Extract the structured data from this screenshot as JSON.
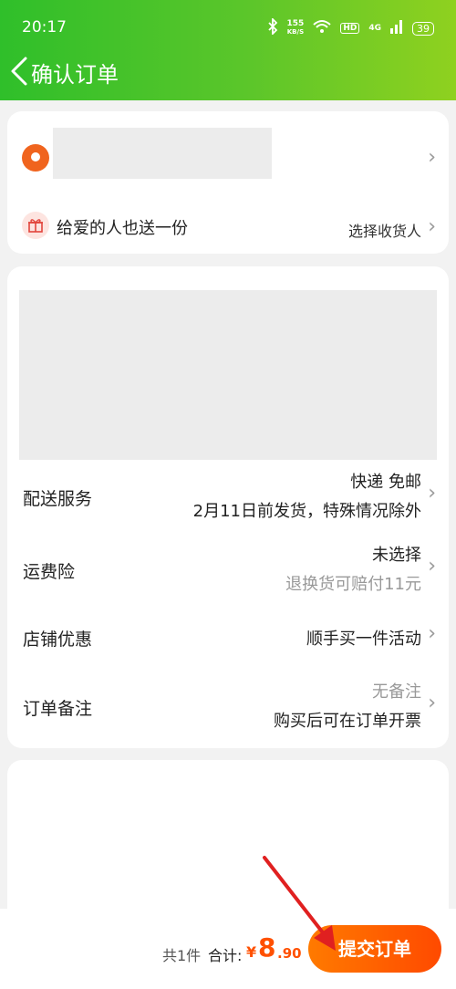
{
  "status_bar": {
    "time": "20:17",
    "speed_value": "155",
    "speed_unit": "KB/S",
    "hd": "HD",
    "network": "4G",
    "battery": "39"
  },
  "nav": {
    "title": "确认订单"
  },
  "address": {
    "gift_text": "给爱的人也送一份",
    "gift_action": "选择收货人"
  },
  "rows": {
    "delivery": {
      "label": "配送服务",
      "value1": "快递 免邮",
      "value2": "2月11日前发货，特殊情况除外"
    },
    "insurance": {
      "label": "运费险",
      "value1": "未选择",
      "value2": "退换货可赔付11元"
    },
    "discount": {
      "label": "店铺优惠",
      "value1": "顺手买一件活动"
    },
    "note": {
      "label": "订单备注",
      "value1": "无备注",
      "value2": "购买后可在订单开票"
    }
  },
  "footer": {
    "count": "共1件",
    "total_label": "合计:",
    "currency": "¥",
    "amount_int": "8",
    "amount_dec": ".90",
    "submit_label": "提交订单"
  },
  "colors": {
    "header_gradient_start": "#2fbf2a",
    "header_gradient_end": "#8fd11f",
    "accent_orange": "#ff5000",
    "arrow_red": "#e02020"
  },
  "icons": [
    "bluetooth-icon",
    "wifi-icon",
    "signal-icon",
    "battery-icon",
    "back-chevron-icon",
    "location-pin-icon",
    "gift-icon",
    "chevron-right-icon",
    "annotation-arrow"
  ]
}
